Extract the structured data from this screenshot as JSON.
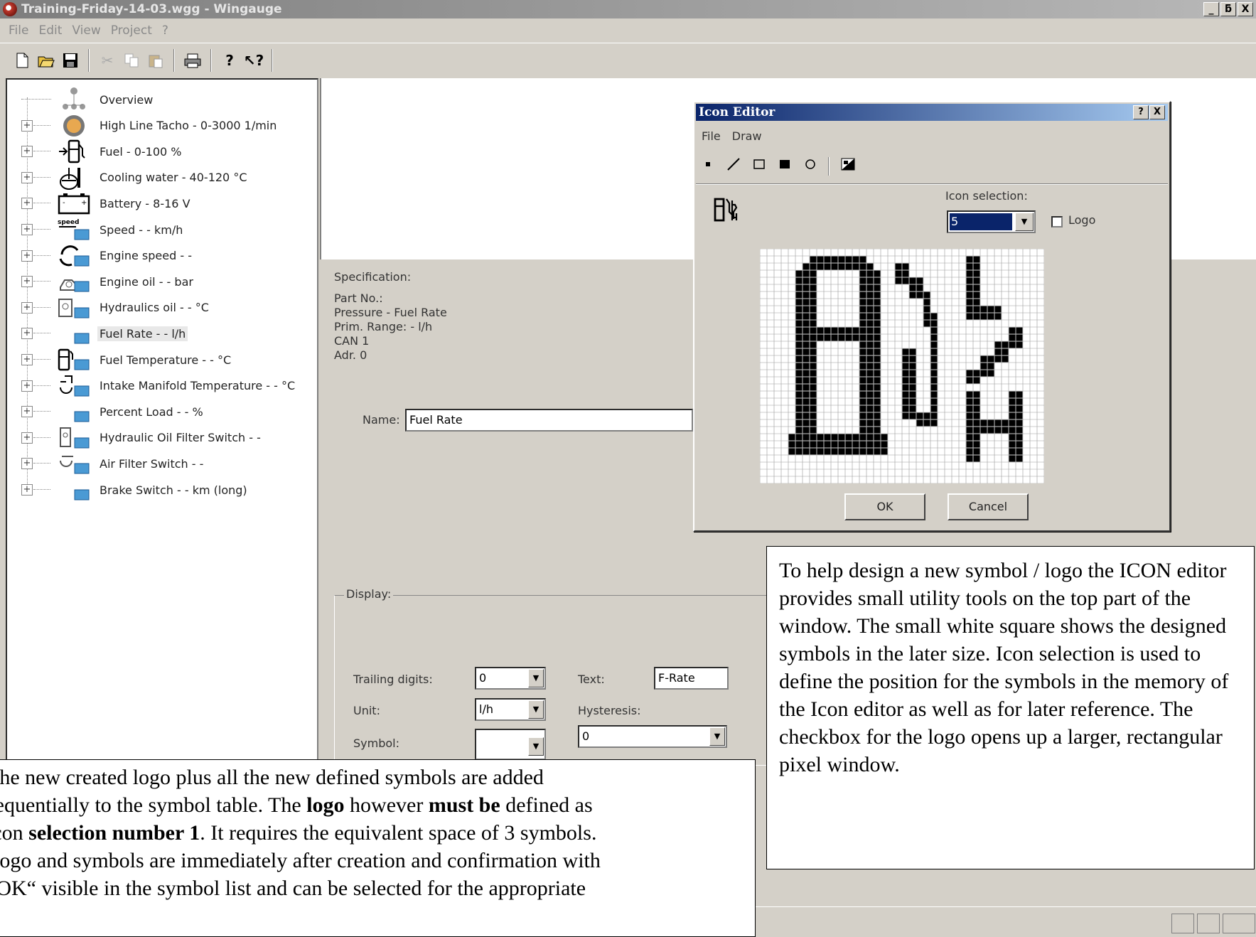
{
  "window": {
    "title": "Training-Friday-14-03.wgg - Wingauge",
    "minimize": "_",
    "maximize": "ƃ",
    "close": "X"
  },
  "menu": [
    "File",
    "Edit",
    "View",
    "Project",
    "?"
  ],
  "toolbar_icons": [
    "new-file-icon",
    "open-folder-icon",
    "save-icon",
    "cut-icon",
    "copy-icon",
    "paste-icon",
    "print-icon",
    "help-icon",
    "context-help-icon"
  ],
  "tree": {
    "items": [
      {
        "label": "Overview",
        "icon": "overview-icon",
        "expandable": false
      },
      {
        "label": "High Line Tacho - 0-3000 1/min",
        "icon": "tachometer-icon",
        "expandable": true
      },
      {
        "label": "Fuel - 0-100 %",
        "icon": "fuel-pump-icon",
        "expandable": true
      },
      {
        "label": "Cooling water - 40-120 °C",
        "icon": "coolant-temperature-icon",
        "expandable": true
      },
      {
        "label": "Battery - 8-16 V",
        "icon": "battery-icon",
        "expandable": true
      },
      {
        "label": "Speed - - km/h",
        "icon": "speed-icon",
        "expandable": true
      },
      {
        "label": "Engine speed - -",
        "icon": "engine-speed-icon",
        "expandable": true
      },
      {
        "label": "Engine oil - - bar",
        "icon": "engine-oil-icon",
        "expandable": true
      },
      {
        "label": "Hydraulics oil - - °C",
        "icon": "hydraulic-oil-icon",
        "expandable": true
      },
      {
        "label": "Fuel Rate - - l/h",
        "icon": "display-icon",
        "expandable": true,
        "selected": true
      },
      {
        "label": "Fuel Temperature - - °C",
        "icon": "fuel-temperature-icon",
        "expandable": true
      },
      {
        "label": "Intake Manifold Temperature - - °C",
        "icon": "intake-manifold-icon",
        "expandable": true
      },
      {
        "label": "Percent Load - - %",
        "icon": "display-icon",
        "expandable": true
      },
      {
        "label": "Hydraulic Oil Filter Switch - -",
        "icon": "oil-filter-icon",
        "expandable": true
      },
      {
        "label": "Air Filter Switch - -",
        "icon": "air-filter-icon",
        "expandable": true
      },
      {
        "label": "Brake Switch - - km (long)",
        "icon": "display-icon",
        "expandable": true
      }
    ]
  },
  "specification": {
    "heading": "Specification:",
    "lines": [
      "Part No.:",
      "Pressure - Fuel Rate",
      "Prim. Range: - l/h",
      "CAN 1",
      "Adr. 0"
    ]
  },
  "name_field": {
    "label": "Name:",
    "value": "Fuel Rate"
  },
  "display": {
    "legend": "Display:",
    "trailing_digits": {
      "label": "Trailing digits:",
      "value": "0"
    },
    "unit": {
      "label": "Unit:",
      "value": "l/h"
    },
    "symbol": {
      "label": "Symbol:",
      "value": ""
    },
    "text": {
      "label": "Text:",
      "value": "F-Rate"
    },
    "hysteresis": {
      "label": "Hysteresis:",
      "value": "0"
    }
  },
  "icon_editor": {
    "title": "Icon Editor",
    "help_btn": "?",
    "close_btn": "X",
    "menu": [
      "File",
      "Draw"
    ],
    "tools": [
      "pixel-tool-icon",
      "line-tool-icon",
      "rectangle-tool-icon",
      "filled-rectangle-tool-icon",
      "circle-tool-icon",
      "invert-tool-icon"
    ],
    "icon_selection_label": "Icon selection:",
    "icon_selection_value": "5",
    "logo_label": "Logo",
    "logo_checked": false,
    "ok_label": "OK",
    "cancel_label": "Cancel"
  },
  "callouts": {
    "right": "To help design a new symbol / logo the ICON editor provides small utility tools on the top part of the window. The small white square shows the designed symbols in the later size. Icon selection is used to define the position for the symbols in the memory of the Icon editor as well as for later reference. The checkbox for the logo opens up a larger, rectangular pixel window.",
    "left_l1": "The new created logo plus all the new defined symbols are added",
    "left_l2a": "sequentially to the symbol table. The ",
    "left_l2b": "logo",
    "left_l2c": " however ",
    "left_l2d": "must be",
    "left_l2e": " defined as",
    "left_l3a": "icon ",
    "left_l3b": "selection number 1",
    "left_l3c": ". It requires the equivalent space of 3 symbols.",
    "left_l4": "Logo and symbols are immediately after creation and confirmation with",
    "left_l5": "„OK“ visible in the symbol list and can be selected for the appropriate"
  },
  "colors": {
    "title_active": "#0a246a",
    "face": "#d4d0c8",
    "selection": "#0a246a"
  }
}
